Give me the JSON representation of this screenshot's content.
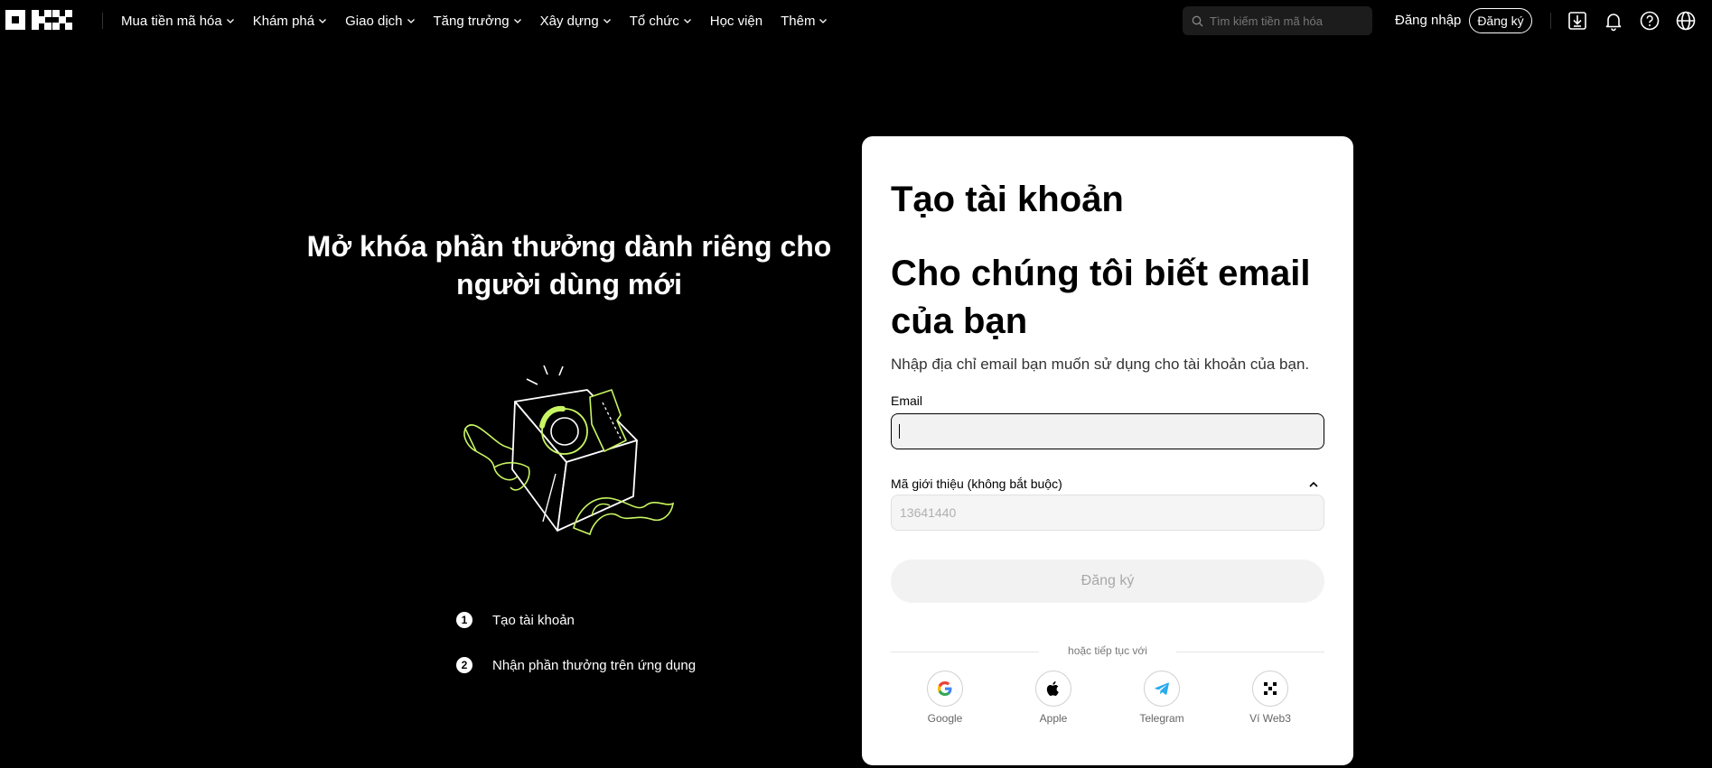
{
  "brand": {
    "name": "OKX"
  },
  "nav": {
    "items": [
      {
        "label": "Mua tiền mã hóa",
        "dropdown": true
      },
      {
        "label": "Khám phá",
        "dropdown": true
      },
      {
        "label": "Giao dịch",
        "dropdown": true
      },
      {
        "label": "Tăng trưởng",
        "dropdown": true
      },
      {
        "label": "Xây dựng",
        "dropdown": true
      },
      {
        "label": "Tổ chức",
        "dropdown": true
      },
      {
        "label": "Học viện",
        "dropdown": false
      },
      {
        "label": "Thêm",
        "dropdown": true
      }
    ],
    "search_placeholder": "Tìm kiếm tiền mã hóa",
    "login_label": "Đăng nhập",
    "signup_label": "Đăng ký",
    "icons": [
      "download-icon",
      "bell-icon",
      "help-icon",
      "globe-icon"
    ]
  },
  "promo": {
    "title": "Mở khóa phần thưởng dành riêng cho người dùng mới",
    "steps": [
      {
        "number": "1",
        "label": "Tạo tài khoản"
      },
      {
        "number": "2",
        "label": "Nhận phần thưởng trên ứng dụng"
      }
    ],
    "accent_color": "#C8F562"
  },
  "form": {
    "title": "Tạo tài khoản",
    "heading": "Cho chúng tôi biết email của bạn",
    "subtitle": "Nhập địa chỉ email bạn muốn sử dụng cho tài khoản của bạn.",
    "email_label": "Email",
    "email_value": "",
    "referral_label": "Mã giới thiệu (không bắt buộc)",
    "referral_placeholder": "13641440",
    "submit_label": "Đăng ký",
    "divider_text": "hoặc tiếp tục với",
    "social": [
      {
        "name": "Google",
        "icon": "google-icon"
      },
      {
        "name": "Apple",
        "icon": "apple-icon"
      },
      {
        "name": "Telegram",
        "icon": "telegram-icon"
      },
      {
        "name": "Ví Web3",
        "icon": "okx-wallet-icon"
      }
    ]
  }
}
